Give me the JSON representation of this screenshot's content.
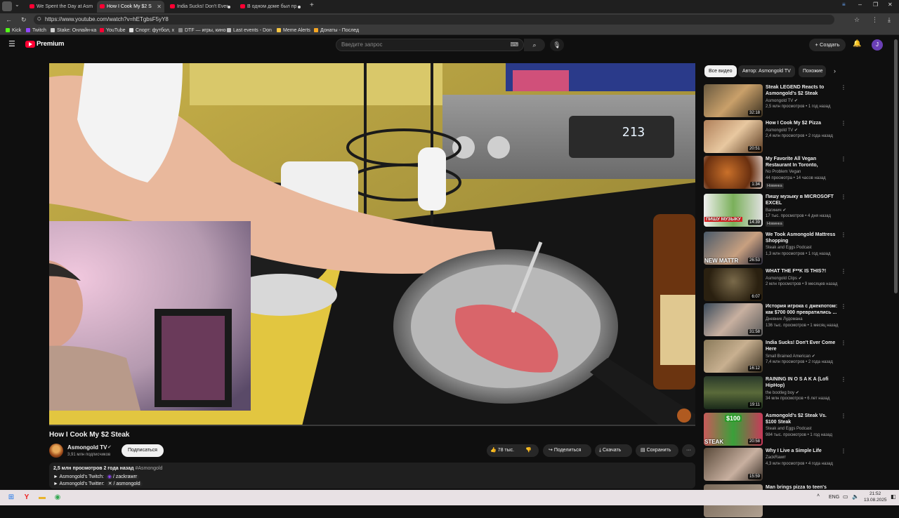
{
  "browser": {
    "tabs": [
      {
        "title": "We Spent the Day at Asm",
        "active": false
      },
      {
        "title": "How I Cook My $2 S",
        "active": true
      },
      {
        "title": "India Sucks! Don't Ever",
        "active": false
      },
      {
        "title": "В одном доме был пр",
        "active": false
      }
    ],
    "url": "https://www.youtube.com/watch?v=hETgbsF5yY8",
    "bookmarks": [
      "Kick",
      "Twitch",
      "Stake: Онлайн-ка",
      "YouTube",
      "Спорт: футбол, х",
      "DTF — игры, кино",
      "Last events - Don",
      "Meme Alerts",
      "Донаты - Послед"
    ]
  },
  "yt_header": {
    "logo_text": "Premium",
    "search_placeholder": "Введите запрос",
    "create_label": "Создать",
    "avatar_letter": "J"
  },
  "player": {
    "stove_display": "213",
    "progress_fraction": 0.0
  },
  "video": {
    "title": "How I Cook My $2 Steak",
    "channel": "Asmongold TV",
    "subscribers": "3,91 млн подписчиков",
    "subscribe_label": "Подписаться",
    "likes": "78 тыс.",
    "share_label": "Поделиться",
    "download_label": "Скачать",
    "save_label": "Сохранить",
    "more_label": "···"
  },
  "description": {
    "stats": "2,5 млн просмотров  2 года назад",
    "hashtag": "#Asmongold",
    "twitch_label": "► Asmongold's Twitch:",
    "twitch_handle": "/ zackrawrr",
    "twitter_label": "► Asmongold's Twitter:",
    "twitter_handle": "/ asmongold"
  },
  "sidebar": {
    "chips": [
      "Все видео",
      "Автор: Asmongold TV",
      "Похожие"
    ],
    "recommendations": [
      {
        "title": "Steak LEGEND Reacts to Asmongold's $2 Steak",
        "channel": "Asmongold TV",
        "meta": "2,5 млн просмотров • 1 год назад",
        "duration": "32:18",
        "badge": ""
      },
      {
        "title": "How I Cook My $2 Pizza",
        "channel": "Asmongold TV",
        "meta": "2,4 млн просмотров • 2 года назад",
        "duration": "20:51",
        "badge": ""
      },
      {
        "title": "My Favorite All Vegan Restaurant In Toronto, Canada...",
        "channel": "No Problem Vegan",
        "meta": "44 просмотра • 14 часов назад",
        "duration": "1:34",
        "badge": "Новинка"
      },
      {
        "title": "Пишу музыку в MICROSOFT EXCEL",
        "channel": "Вагинич",
        "meta": "17 тыс. просмотров • 4 дня назад",
        "duration": "14:39",
        "badge": "Новинка"
      },
      {
        "title": "We Took Asmongold Mattress Shopping",
        "channel": "Steak and Eggs Podcast",
        "meta": "1,3 млн просмотров • 1 год назад",
        "duration": "26:53",
        "badge": ""
      },
      {
        "title": "WHAT THE F**K IS THIS?!",
        "channel": "Asmongold Clips",
        "meta": "2 млн просмотров • 9 месяцев назад",
        "duration": "6:07",
        "badge": ""
      },
      {
        "title": "История игрока с джекпотом: как $700 000 превратились ...",
        "channel": "Дневник Лудомана",
        "meta": "136 тыс. просмотров • 1 месяц назад",
        "duration": "31:58",
        "badge": ""
      },
      {
        "title": "India Sucks! Don't Ever Come Here",
        "channel": "Small Brained American",
        "meta": "7,4 млн просмотров • 2 года назад",
        "duration": "16:12",
        "badge": ""
      },
      {
        "title": "RAINING IN O S A K A (Lofi HipHop)",
        "channel": "the bootleg boy",
        "meta": "34 млн просмотров • 6 лет назад",
        "duration": "19:11",
        "badge": ""
      },
      {
        "title": "Asmongold's $2 Steak Vs. $100 Steak",
        "channel": "Steak and Eggs Podcast",
        "meta": "984 тыс. просмотров • 1 год назад",
        "duration": "20:58",
        "badge": ""
      },
      {
        "title": "Why I Live a Simple Life",
        "channel": "ZackRawrr",
        "meta": "4,3 млн просмотров • 4 года назад",
        "duration": "15:59",
        "badge": ""
      },
      {
        "title": "Man brings pizza to teen's",
        "channel": "",
        "meta": "",
        "duration": "",
        "badge": ""
      }
    ],
    "thumb_texts": {
      "excel": "ПИШУ МУЗЫКУ",
      "mattress": "NEW MATTR",
      "steak": "STEAK",
      "price": "$100"
    }
  },
  "taskbar": {
    "lang": "ENG",
    "time": "21:52",
    "date": "13.08.2025"
  },
  "colors": {
    "yt_red": "#ff0033",
    "link_blue": "#3ea6ff",
    "bg": "#0f0f0f"
  }
}
